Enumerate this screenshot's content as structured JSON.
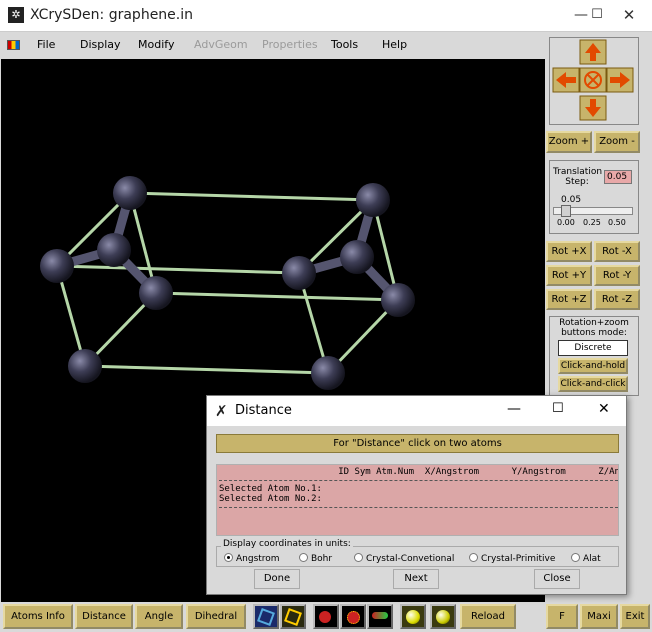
{
  "window": {
    "title": "XCrySDen: graphene.in",
    "controls": [
      "minimize-icon",
      "maximize-icon",
      "close-icon"
    ]
  },
  "menu": [
    "File",
    "Display",
    "Modify",
    "AdvGeom",
    "Properties",
    "Tools",
    "Help"
  ],
  "menu_disabled": [
    "AdvGeom",
    "Properties"
  ],
  "right_panel": {
    "zoom_in": "Zoom +",
    "zoom_out": "Zoom -",
    "translation_label": "Translation Step:",
    "translation_value": "0.05",
    "slider_value": "0.05",
    "slider_value_fraction": 0.1,
    "slider_ticks": [
      "0.00",
      "0.25",
      "0.50"
    ],
    "rot": [
      "Rot +X",
      "Rot -X",
      "Rot +Y",
      "Rot -Y",
      "Rot +Z",
      "Rot -Z"
    ],
    "mode_label": "Rotation+zoom buttons mode:",
    "mode_discrete": "Discrete",
    "mode_hold": "Click-and-hold",
    "mode_click": "Click-and-click"
  },
  "bottom": {
    "atoms_info": "Atoms Info",
    "distance": "Distance",
    "angle": "Angle",
    "dihedral": "Dihedral",
    "reload": "Reload",
    "f": "F",
    "maxi": "Maxi",
    "exit": "Exit"
  },
  "dialog": {
    "title": "Distance",
    "banner": "For \"Distance\" click on two atoms",
    "header": "                      ID Sym Atm.Num  X/Angstrom      Y/Angstrom      Z/Angstrom",
    "line1": "Selected Atom No.1:",
    "line2": "Selected Atom No.2:",
    "units_legend": "Display coordinates in units:",
    "units": [
      "Angstrom",
      "Bohr",
      "Crystal-Convetional",
      "Crystal-Primitive",
      "Alat"
    ],
    "selected_unit": "Angstrom",
    "done": "Done",
    "next": "Next",
    "close": "Close"
  },
  "colors": {
    "button_gold": "#c7b46b",
    "canvas_bg": "#000000",
    "atom": "#3d3d55",
    "bond": "#b5d6a8",
    "text_area": "#dba6a6"
  }
}
